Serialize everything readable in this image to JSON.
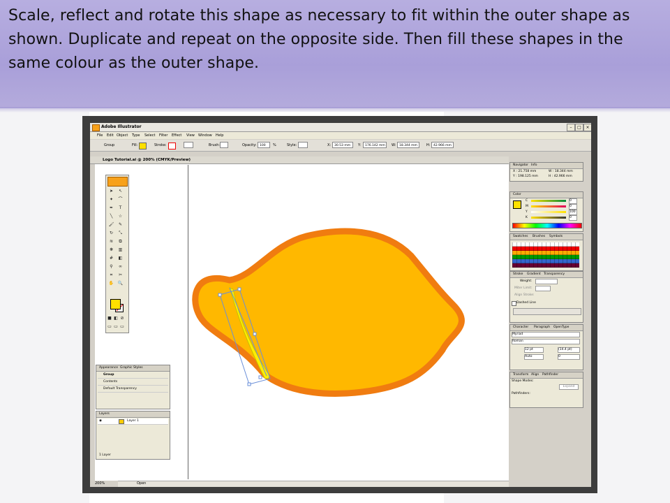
{
  "slide": {
    "instruction": "Scale, reflect and rotate this shape as necessary to fit within the outer shape as shown. Duplicate and repeat on the opposite side. Then fill these shapes in the same colour as the outer shape."
  },
  "app": {
    "title": "Adobe Illustrator",
    "menu": [
      "File",
      "Edit",
      "Object",
      "Type",
      "Select",
      "Filter",
      "Effect",
      "View",
      "Window",
      "Help"
    ],
    "control_bar": {
      "selection": "Group",
      "fill_label": "Fill:",
      "stroke_label": "Stroke:",
      "brush_label": "Brush:",
      "opacity_label": "Opacity:",
      "opacity_value": "100",
      "percent": "%",
      "style_label": "Style:",
      "x_label": "X:",
      "x_value": "30.53 mm",
      "y_label": "Y:",
      "y_value": "176.142 mm",
      "w_label": "W:",
      "w_value": "18.344 mm",
      "h_label": "H:",
      "h_value": "42.966 mm"
    },
    "document_tab": "Logo Tutorial.ai @ 200% (CMYK/Preview)",
    "status": {
      "zoom": "200%",
      "mode": "Open"
    }
  },
  "panels": {
    "navigator": {
      "tabs": [
        "Navigator",
        "Info"
      ],
      "x": "X : 21.758 mm",
      "y": "Y : 198.125 mm",
      "w": "W : 18.344 mm",
      "h": "H : 42.966 mm"
    },
    "color": {
      "tab": "Color",
      "channels": [
        "C",
        "M",
        "Y",
        "K"
      ],
      "values": [
        "0",
        "0",
        "100",
        "0"
      ],
      "unit": "%"
    },
    "swatches": {
      "tabs": [
        "Swatches",
        "Brushes",
        "Symbols"
      ]
    },
    "stroke": {
      "tabs": [
        "Stroke",
        "Gradient",
        "Transparency"
      ],
      "weight_label": "Weight:",
      "miter_label": "Miter Limit:",
      "align_label": "Align Stroke:",
      "dashed_label": "Dashed Line"
    },
    "character": {
      "tabs": [
        "Character",
        "Paragraph",
        "OpenType"
      ],
      "font": "Myriad",
      "style": "Roman",
      "size": "12 pt",
      "leading": "(14.4 pt)",
      "kerning": "Auto",
      "tracking": "0"
    },
    "pathfinder": {
      "tabs": [
        "Transform",
        "Align",
        "Pathfinder"
      ],
      "shape_modes_label": "Shape Modes:",
      "expand_label": "Expand",
      "pathfinders_label": "Pathfinders:"
    },
    "appearance": {
      "tabs": [
        "Appearance",
        "Graphic Styles"
      ],
      "items": [
        "Group",
        "Contents",
        "Default Transparency"
      ]
    },
    "layers": {
      "tab": "Layers",
      "layer_name": "Layer 1",
      "count": "1 Layer"
    }
  },
  "colors": {
    "outer_shape_stroke": "#f07c10",
    "outer_shape_fill": "#ffb800",
    "inner_shape_fill": "#ffee00",
    "selection_outline": "#6a8fd8"
  }
}
